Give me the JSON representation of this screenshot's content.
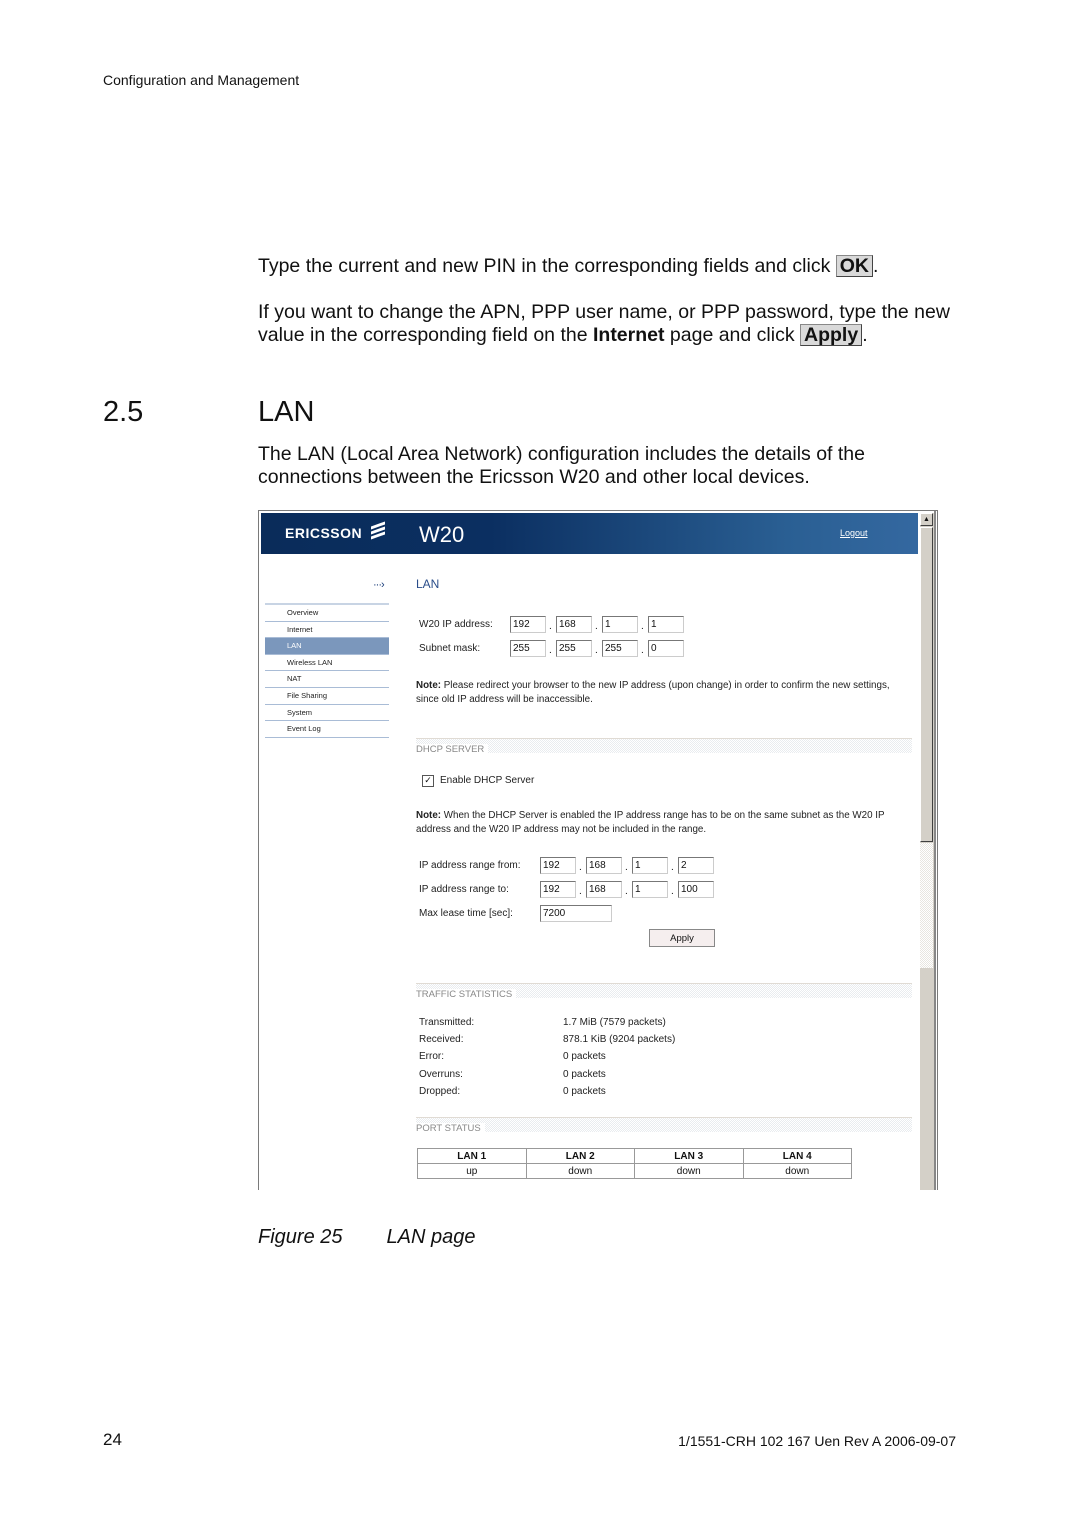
{
  "header": {
    "running_head": "Configuration and Management"
  },
  "body": {
    "para1_text": "Type the current and new PIN in the corresponding fields and click ",
    "para1_button": "OK",
    "para2_text_a": "If you want to change the APN, PPP user name, or PPP password, type the new value in the corresponding field on the ",
    "para2_bold": "Internet",
    "para2_text_b": " page and click ",
    "para2_button": "Apply",
    "section_number": "2.5",
    "section_title": "LAN",
    "section_intro": "The LAN (Local Area Network) configuration includes the details of the connections between the Ericsson W20 and other local devices."
  },
  "screenshot": {
    "brand": "ERICSSON",
    "product": "W20",
    "logout": "Logout",
    "page_heading": "LAN",
    "nav": [
      {
        "label": "Overview",
        "active": false
      },
      {
        "label": "Internet",
        "active": false
      },
      {
        "label": "LAN",
        "active": true
      },
      {
        "label": "Wireless LAN",
        "active": false
      },
      {
        "label": "NAT",
        "active": false
      },
      {
        "label": "File Sharing",
        "active": false
      },
      {
        "label": "System",
        "active": false
      },
      {
        "label": "Event Log",
        "active": false
      }
    ],
    "ip_label": "W20 IP address:",
    "ip": [
      "192",
      "168",
      "1",
      "1"
    ],
    "mask_label": "Subnet mask:",
    "mask": [
      "255",
      "255",
      "255",
      "0"
    ],
    "note1_bold": "Note:",
    "note1_text": " Please redirect your browser to the new IP address (upon change) in order to confirm the new settings, since old IP address will be inaccessible.",
    "dhcp_title": "DHCP SERVER",
    "dhcp_enable_label": "Enable DHCP Server",
    "dhcp_enabled": true,
    "note2_bold": "Note:",
    "note2_text": " When the DHCP Server is enabled the IP address range has to be on the same subnet as the W20 IP address and the W20 IP address may not be included in the range.",
    "range_from_label": "IP address range from:",
    "range_from": [
      "192",
      "168",
      "1",
      "2"
    ],
    "range_to_label": "IP address range to:",
    "range_to": [
      "192",
      "168",
      "1",
      "100"
    ],
    "lease_label": "Max lease time [sec]:",
    "lease": "7200",
    "apply": "Apply",
    "traffic_title": "TRAFFIC STATISTICS",
    "stats": [
      {
        "label": "Transmitted:",
        "value": "1.7 MiB (7579 packets)"
      },
      {
        "label": "Received:",
        "value": "878.1 KiB (9204 packets)"
      },
      {
        "label": "Error:",
        "value": "0 packets"
      },
      {
        "label": "Overruns:",
        "value": "0 packets"
      },
      {
        "label": "Dropped:",
        "value": "0 packets"
      }
    ],
    "port_title": "PORT STATUS",
    "ports": [
      {
        "name": "LAN 1",
        "status": "up"
      },
      {
        "name": "LAN 2",
        "status": "down"
      },
      {
        "name": "LAN 3",
        "status": "down"
      },
      {
        "name": "LAN 4",
        "status": "down"
      }
    ]
  },
  "figure": {
    "label": "Figure 25",
    "title": "LAN page"
  },
  "footer": {
    "page_number": "24",
    "doc_id": "1/1551-CRH 102 167 Uen Rev A  2006-09-07"
  }
}
